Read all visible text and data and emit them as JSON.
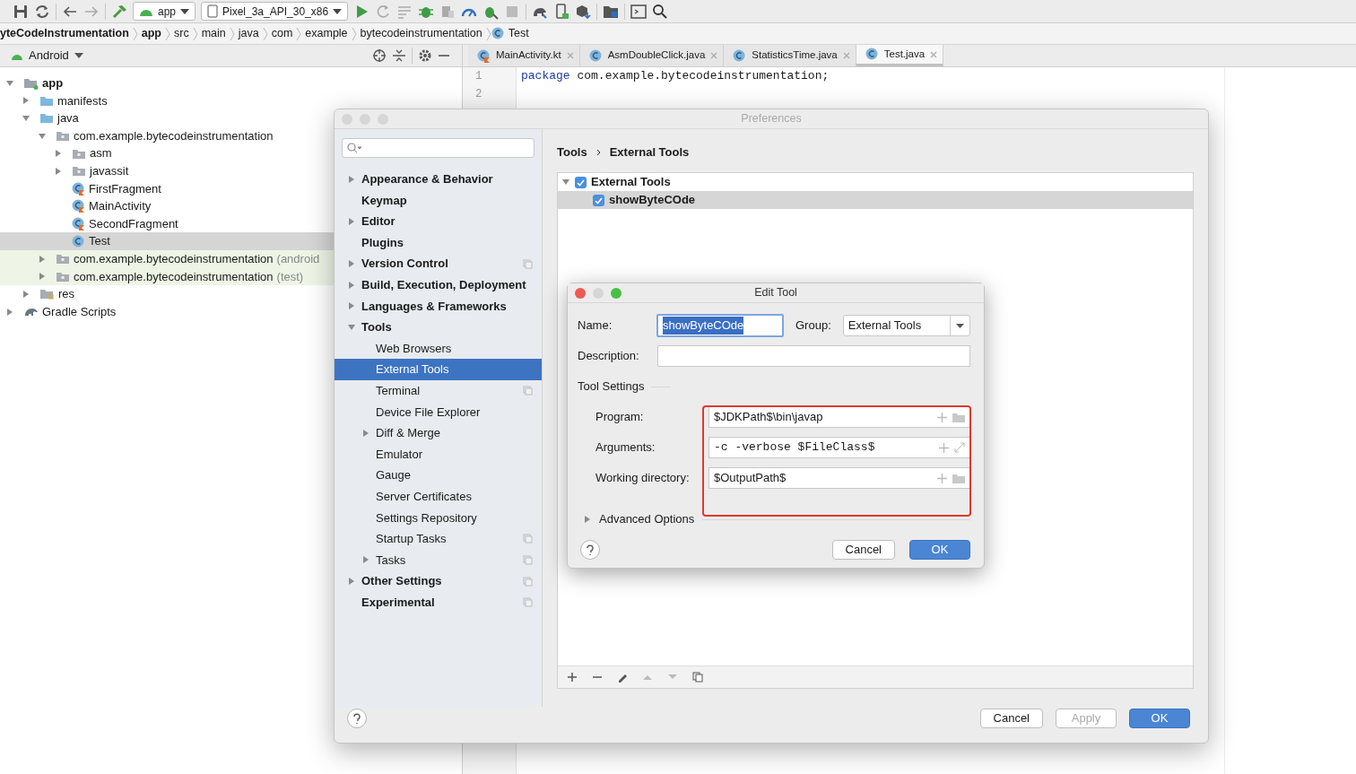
{
  "toolbar": {
    "run_config": "app",
    "device": "Pixel_3a_API_30_x86"
  },
  "breadcrumb": [
    "yteCodeInstrumentation",
    "app",
    "src",
    "main",
    "java",
    "com",
    "example",
    "bytecodeinstrumentation",
    "Test"
  ],
  "project_pane": {
    "view": "Android",
    "tree": [
      {
        "label": "app",
        "kind": "module",
        "expanded": true,
        "selected": false,
        "children": [
          {
            "label": "manifests",
            "kind": "folder",
            "expanded": false,
            "selected": false
          },
          {
            "label": "java",
            "kind": "folder",
            "expanded": true,
            "selected": false,
            "children": [
              {
                "label": "com.example.bytecodeinstrumentation",
                "kind": "package",
                "expanded": true,
                "selected": false,
                "children": [
                  {
                    "label": "asm",
                    "kind": "package",
                    "expanded": false,
                    "selected": false
                  },
                  {
                    "label": "javassit",
                    "kind": "package",
                    "expanded": false,
                    "selected": false
                  },
                  {
                    "label": "FirstFragment",
                    "kind": "kotlin",
                    "selected": false
                  },
                  {
                    "label": "MainActivity",
                    "kind": "kotlin",
                    "selected": false
                  },
                  {
                    "label": "SecondFragment",
                    "kind": "kotlin",
                    "selected": false
                  },
                  {
                    "label": "Test",
                    "kind": "java",
                    "selected": true
                  }
                ]
              },
              {
                "label": "com.example.bytecodeinstrumentation",
                "suffix": "(android",
                "kind": "test_package",
                "expanded": false,
                "selected": false
              },
              {
                "label": "com.example.bytecodeinstrumentation",
                "suffix": "(test)",
                "kind": "test_package",
                "expanded": false,
                "selected": false
              }
            ]
          },
          {
            "label": "res",
            "kind": "res",
            "expanded": false,
            "selected": false
          }
        ]
      },
      {
        "label": "Gradle Scripts",
        "kind": "gradle",
        "expanded": false,
        "selected": false
      }
    ]
  },
  "editor_tabs": [
    {
      "label": "MainActivity.kt",
      "kind": "kotlin",
      "selected": false
    },
    {
      "label": "AsmDoubleClick.java",
      "kind": "java",
      "selected": false
    },
    {
      "label": "StatisticsTime.java",
      "kind": "java",
      "selected": false
    },
    {
      "label": "Test.java",
      "kind": "java",
      "selected": true
    }
  ],
  "editor": {
    "lines": [
      {
        "number": "1",
        "keyword": "package",
        "text": "com.example.bytecodeinstrumentation;"
      },
      {
        "number": "2"
      }
    ]
  },
  "preferences": {
    "title": "Preferences",
    "sidebar": [
      {
        "label": "Appearance & Behavior",
        "expanded": false,
        "selected": false,
        "project_scope": false
      },
      {
        "label": "Keymap",
        "selected": false,
        "project_scope": false
      },
      {
        "label": "Editor",
        "expanded": false,
        "selected": false,
        "project_scope": false
      },
      {
        "label": "Plugins",
        "selected": false,
        "project_scope": false
      },
      {
        "label": "Version Control",
        "expanded": false,
        "selected": false,
        "project_scope": true
      },
      {
        "label": "Build, Execution, Deployment",
        "expanded": false,
        "selected": false,
        "project_scope": false
      },
      {
        "label": "Languages & Frameworks",
        "expanded": false,
        "selected": false,
        "project_scope": false
      },
      {
        "label": "Tools",
        "expanded": true,
        "selected": false,
        "project_scope": false,
        "children": [
          {
            "label": "Web Browsers",
            "selected": false,
            "project_scope": false
          },
          {
            "label": "External Tools",
            "selected": true,
            "project_scope": false
          },
          {
            "label": "Terminal",
            "selected": false,
            "project_scope": true
          },
          {
            "label": "Device File Explorer",
            "selected": false,
            "project_scope": false
          },
          {
            "label": "Diff & Merge",
            "expanded": false,
            "selected": false,
            "project_scope": false
          },
          {
            "label": "Emulator",
            "selected": false,
            "project_scope": false
          },
          {
            "label": "Gauge",
            "selected": false,
            "project_scope": false
          },
          {
            "label": "Server Certificates",
            "selected": false,
            "project_scope": false
          },
          {
            "label": "Settings Repository",
            "selected": false,
            "project_scope": false
          },
          {
            "label": "Startup Tasks",
            "selected": false,
            "project_scope": true
          },
          {
            "label": "Tasks",
            "expanded": false,
            "selected": false,
            "project_scope": true
          }
        ]
      },
      {
        "label": "Other Settings",
        "expanded": false,
        "selected": false,
        "project_scope": true
      },
      {
        "label": "Experimental",
        "selected": false,
        "project_scope": true
      }
    ],
    "path": [
      "Tools",
      "External Tools"
    ],
    "tools_tree": [
      {
        "label": "External Tools",
        "checked": true,
        "expanded": true,
        "selected": false,
        "children": [
          {
            "label": "showByteCOde",
            "checked": true,
            "selected": true
          }
        ]
      }
    ],
    "buttons": [
      {
        "label": "Cancel",
        "kind": "normal",
        "disabled": false
      },
      {
        "label": "Apply",
        "kind": "normal",
        "disabled": true
      },
      {
        "label": "OK",
        "kind": "default",
        "disabled": false
      }
    ]
  },
  "edit_tool": {
    "title": "Edit Tool",
    "name": {
      "label": "Name:",
      "value": "showByteCOde",
      "text_selected": true
    },
    "group": {
      "label": "Group:",
      "value": "External Tools"
    },
    "description": {
      "label": "Description:"
    },
    "section": "Tool Settings",
    "fields": [
      {
        "label": "Program:",
        "value": "$JDKPath$\\bin\\javap",
        "kind": "path"
      },
      {
        "label": "Arguments:",
        "value": "-c -verbose $FileClass$",
        "kind": "args"
      },
      {
        "label": "Working directory:",
        "value": "$OutputPath$",
        "kind": "path"
      }
    ],
    "advanced": {
      "label": "Advanced Options",
      "expanded": false
    },
    "buttons": [
      {
        "label": "Cancel",
        "kind": "normal",
        "disabled": false
      },
      {
        "label": "OK",
        "kind": "default",
        "disabled": false
      }
    ]
  }
}
